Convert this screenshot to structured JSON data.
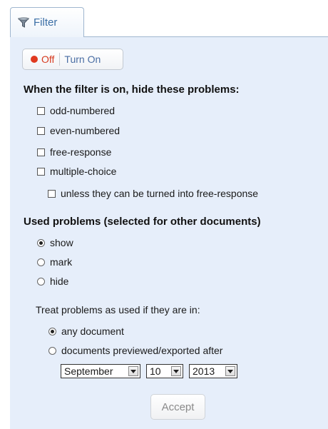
{
  "tab": {
    "label": "Filter",
    "icon": "filter-funnel-icon"
  },
  "toggle": {
    "off_label": "Off",
    "on_label": "Turn On",
    "state_color": "#e0391f"
  },
  "hide_section": {
    "heading": "When the filter is on, hide these problems:",
    "options": [
      {
        "label": "odd-numbered",
        "checked": false
      },
      {
        "label": "even-numbered",
        "checked": false
      },
      {
        "label": "free-response",
        "checked": false
      },
      {
        "label": "multiple-choice",
        "checked": false
      }
    ],
    "sub_option": {
      "label": "unless they can be turned into free-response",
      "checked": false
    }
  },
  "used_section": {
    "heading": "Used problems (selected for other documents)",
    "options": [
      {
        "label": "show",
        "checked": true
      },
      {
        "label": "mark",
        "checked": false
      },
      {
        "label": "hide",
        "checked": false
      }
    ],
    "treat_label": "Treat problems as used if they are in:",
    "treat_options": [
      {
        "label": "any document",
        "checked": true
      },
      {
        "label": "documents previewed/exported after",
        "checked": false
      }
    ],
    "date": {
      "month": "September",
      "day": "10",
      "year": "2013"
    }
  },
  "accept_label": "Accept",
  "colors": {
    "panel_bg": "#e6eefa",
    "tab_text": "#3a6ea5",
    "off_text": "#d63a1f",
    "on_text": "#4a6ea4"
  }
}
